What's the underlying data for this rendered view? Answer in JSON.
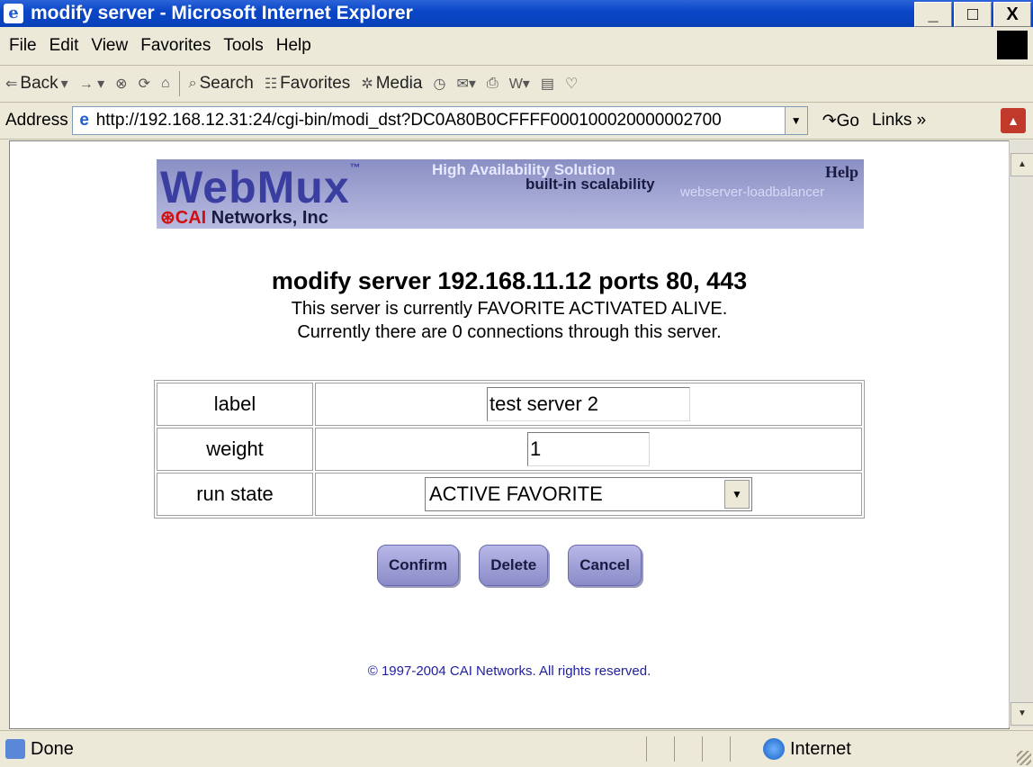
{
  "window": {
    "title": "modify server - Microsoft Internet Explorer",
    "min_label": "_",
    "max_label": "□",
    "close_label": "X"
  },
  "menu": [
    "File",
    "Edit",
    "View",
    "Favorites",
    "Tools",
    "Help"
  ],
  "toolbar": {
    "back_label": "Back",
    "search_label": "Search",
    "favorites_label": "Favorites",
    "media_label": "Media"
  },
  "address": {
    "label": "Address",
    "url": "http://192.168.12.31:24/cgi-bin/modi_dst?DC0A80B0CFFFF000100020000002700",
    "go_label": "Go",
    "links_label": "Links"
  },
  "banner": {
    "logo_text": "WebMux",
    "tagline_1": "High Availability Solution",
    "tagline_2": "built-in scalability",
    "tagline_3": "webserver-loadbalancer",
    "help": "Help",
    "company_red": "CAI",
    "company_rest": " Networks, Inc"
  },
  "page": {
    "heading": "modify server 192.168.11.12 ports 80, 443",
    "status_line": "This server is currently FAVORITE ACTIVATED ALIVE.",
    "connections_line": "Currently there are 0 connections through this server."
  },
  "form": {
    "label_label": "label",
    "label_value": "test server 2",
    "weight_label": "weight",
    "weight_value": "1",
    "runstate_label": "run state",
    "runstate_value": "ACTIVE FAVORITE"
  },
  "buttons": {
    "confirm": "Confirm",
    "delete": "Delete",
    "cancel": "Cancel"
  },
  "footer": "© 1997-2004 CAI Networks. All rights reserved.",
  "status": {
    "text": "Done",
    "zone": "Internet"
  }
}
